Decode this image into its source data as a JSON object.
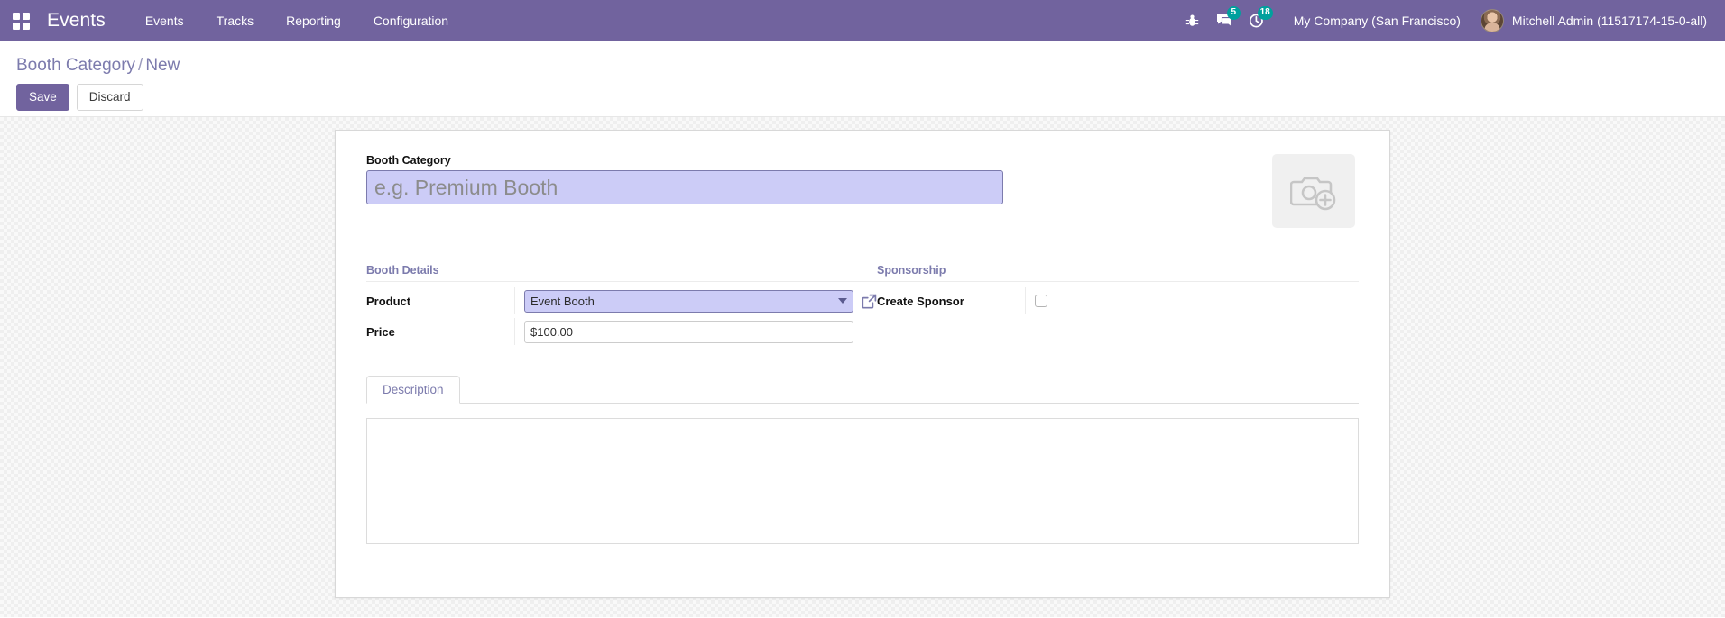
{
  "navbar": {
    "apps_icon": "apps-grid-icon",
    "brand": "Events",
    "menu": [
      {
        "label": "Events"
      },
      {
        "label": "Tracks"
      },
      {
        "label": "Reporting"
      },
      {
        "label": "Configuration"
      }
    ],
    "sys_icons": [
      {
        "name": "bug-icon",
        "badge": null
      },
      {
        "name": "messages-icon",
        "badge": "5"
      },
      {
        "name": "activity-clock-icon",
        "badge": "18"
      }
    ],
    "company": "My Company (San Francisco)",
    "user_name": "Mitchell Admin (11517174-15-0-all)",
    "avatar": "user-avatar",
    "accent_color": "#71639e",
    "badge_color": "#00a09d"
  },
  "control_panel": {
    "breadcrumb_root": "Booth Category",
    "breadcrumb_sep": "/",
    "breadcrumb_current": "New",
    "save_label": "Save",
    "discard_label": "Discard"
  },
  "form": {
    "title_field": {
      "label": "Booth Category",
      "value": "",
      "placeholder": "e.g. Premium Booth"
    },
    "image_placeholder": "image-upload-placeholder",
    "groups": [
      {
        "title": "Booth Details",
        "fields": [
          {
            "label": "Product",
            "value": "Event Booth",
            "type": "select",
            "ext_link": "internal-link-icon"
          },
          {
            "label": "Price",
            "value": "$100.00",
            "type": "text"
          }
        ]
      },
      {
        "title": "Sponsorship",
        "fields": [
          {
            "label": "Create Sponsor",
            "value": "",
            "type": "checkbox",
            "checked": false
          }
        ]
      }
    ],
    "notebook": {
      "tabs": [
        {
          "label": "Description"
        }
      ],
      "editor_content": ""
    }
  }
}
